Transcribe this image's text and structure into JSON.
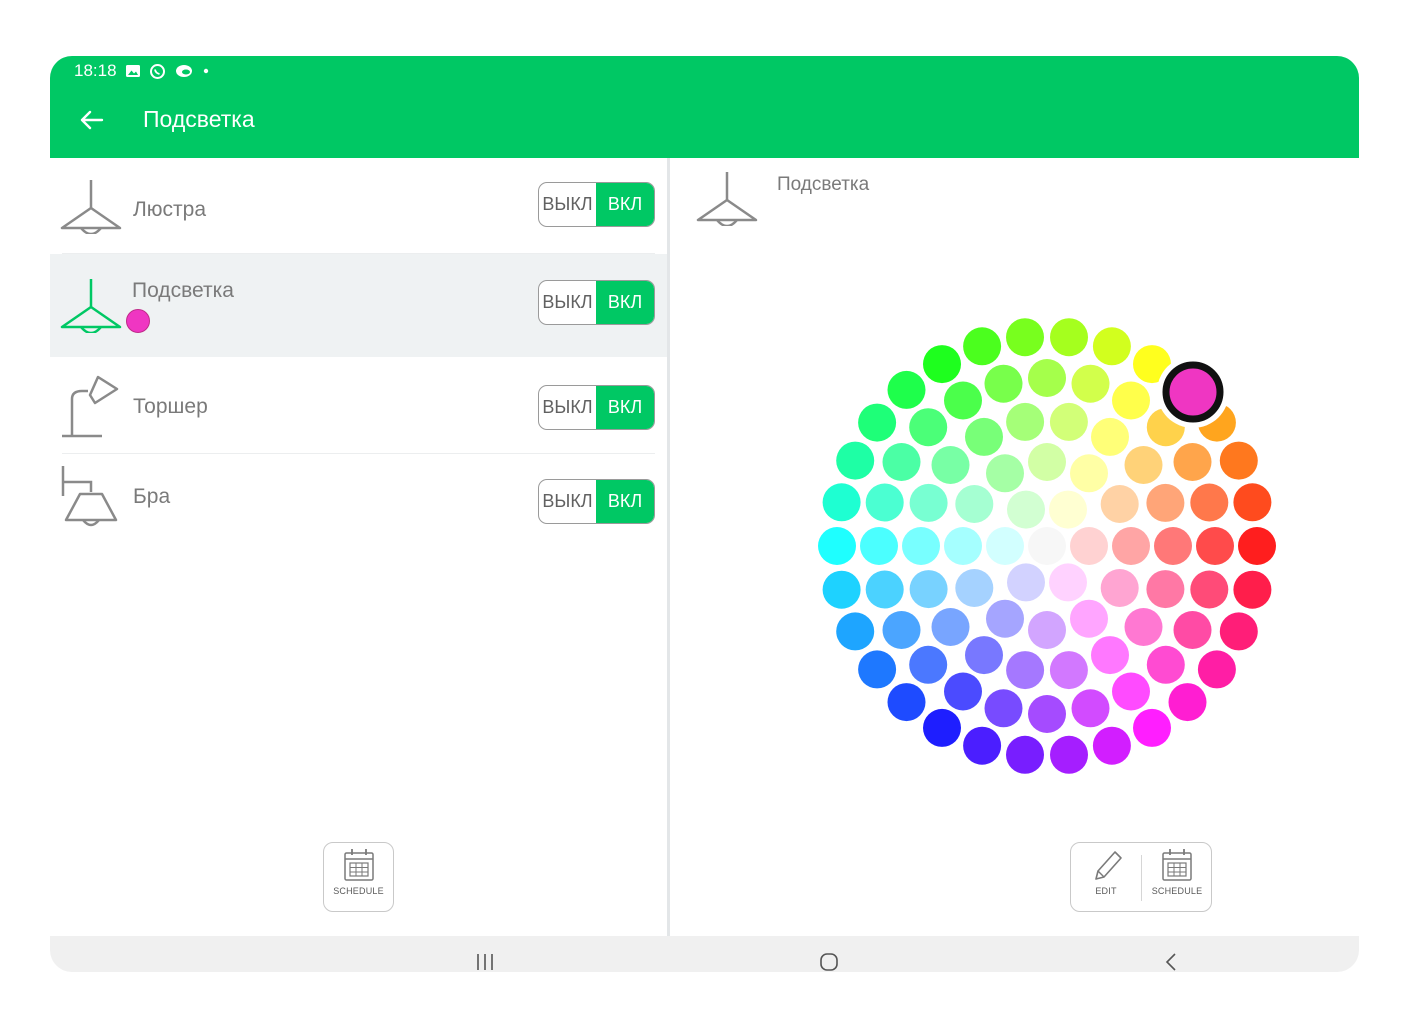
{
  "status_bar": {
    "time": "18:18",
    "icons": [
      "image-icon",
      "whatsapp-icon",
      "cloud-icon",
      "dot-icon"
    ]
  },
  "header": {
    "title": "Подсветка",
    "back_icon": "arrow-left-icon"
  },
  "switch_labels": {
    "off": "ВЫКЛ",
    "on": "ВКЛ"
  },
  "devices": [
    {
      "name": "Люстра",
      "icon": "ceiling-lamp-icon",
      "state": "on",
      "selected": false
    },
    {
      "name": "Подсветка",
      "icon": "ceiling-lamp-icon",
      "state": "on",
      "selected": true,
      "color": "#ef36c2"
    },
    {
      "name": "Торшер",
      "icon": "floor-lamp-icon",
      "state": "on",
      "selected": false
    },
    {
      "name": "Бра",
      "icon": "wall-lamp-icon",
      "state": "on",
      "selected": false
    }
  ],
  "left_toolbar": {
    "schedule_label": "SCHEDULE"
  },
  "detail": {
    "title": "Подсветка",
    "icon": "ceiling-lamp-icon",
    "selected_color": "#ef36c2"
  },
  "right_toolbar": {
    "edit_label": "EDIT",
    "schedule_label": "SCHEDULE"
  },
  "colors": {
    "accent": "#00c864",
    "selected_row_bg": "#eff2f3",
    "icon_gray": "#8a8a8a"
  },
  "nav_bar": {
    "buttons": [
      "recent-apps-icon",
      "home-icon",
      "back-icon"
    ]
  }
}
